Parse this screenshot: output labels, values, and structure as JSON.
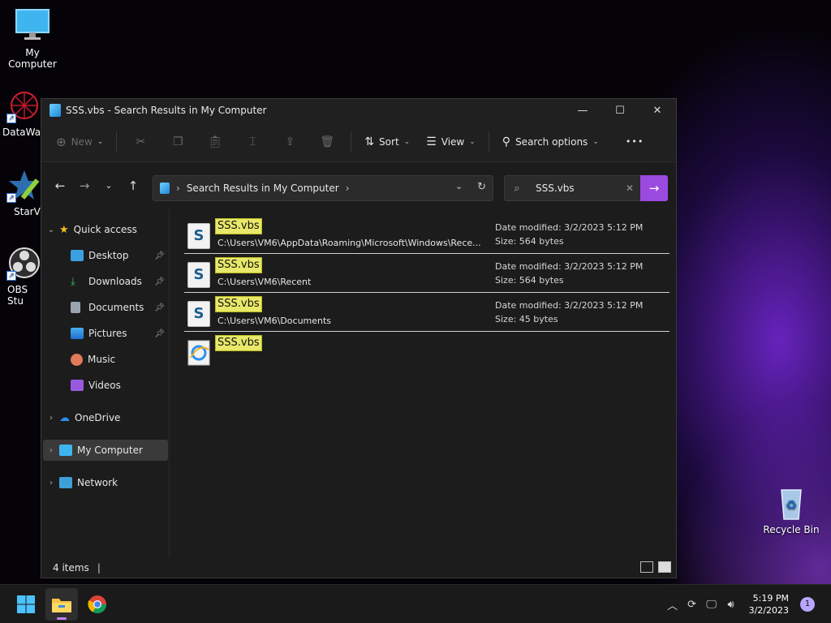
{
  "desktop": {
    "icons": [
      {
        "label": "My Computer"
      },
      {
        "label": "DataWag"
      },
      {
        "label": "StarVP"
      },
      {
        "label": "OBS Stu"
      },
      {
        "label": "Recycle Bin"
      }
    ]
  },
  "window": {
    "title": "SSS.vbs - Search Results in My Computer",
    "toolbar": {
      "new_label": "New",
      "sort_label": "Sort",
      "view_label": "View",
      "search_options_label": "Search options",
      "more_label": "•••"
    },
    "address": {
      "path": "Search Results in My Computer"
    },
    "search": {
      "value": "SSS.vbs"
    },
    "sidebar": {
      "quick_access": "Quick access",
      "items": [
        {
          "label": "Desktop",
          "pinned": true
        },
        {
          "label": "Downloads",
          "pinned": true
        },
        {
          "label": "Documents",
          "pinned": true
        },
        {
          "label": "Pictures",
          "pinned": true
        },
        {
          "label": "Music",
          "pinned": false
        },
        {
          "label": "Videos",
          "pinned": false
        }
      ],
      "onedrive": "OneDrive",
      "my_computer": "My Computer",
      "network": "Network"
    },
    "results": [
      {
        "name": "SSS.vbs",
        "path": "C:\\Users\\VM6\\AppData\\Roaming\\Microsoft\\Windows\\Rece...",
        "date": "Date modified: 3/2/2023 5:12 PM",
        "size": "Size: 564 bytes"
      },
      {
        "name": "SSS.vbs",
        "path": "C:\\Users\\VM6\\Recent",
        "date": "Date modified: 3/2/2023 5:12 PM",
        "size": "Size: 564 bytes"
      },
      {
        "name": "SSS.vbs",
        "path": "C:\\Users\\VM6\\Documents",
        "date": "Date modified: 3/2/2023 5:12 PM",
        "size": "Size: 45 bytes"
      },
      {
        "name": "SSS.vbs",
        "path": "",
        "date": "",
        "size": ""
      }
    ],
    "status": {
      "items_count": "4 items"
    }
  },
  "taskbar": {
    "time": "5:19 PM",
    "date": "3/2/2023",
    "notification_count": "1"
  },
  "colors": {
    "accent": "#9b4ae0",
    "highlight": "#e8e86a"
  }
}
